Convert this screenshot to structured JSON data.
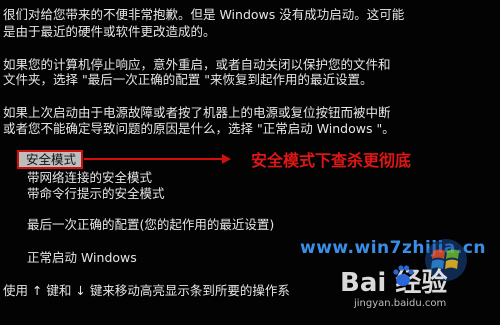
{
  "screen": {
    "intro_lines": [
      "很们对给您带来的不便非常抱歉。但是 Windows 没有成功启动。这可能",
      "是由于最近的硬件或软件更改造成的。"
    ],
    "para2_lines": [
      "如果您的计算机停止响应，意外重启，或者自动关闭以保护您的文件和",
      "文件夹，选择 \"最后一次正确的配置 \"来恢复到起作用的最近设置。"
    ],
    "para3_lines": [
      "如果上次启动由于电源故障或者按了机器上的电源或复位按钮而被中断",
      "或者您不能确定导致问题的原因是什么，选择 \"正常启动 Windows \"。"
    ],
    "options": [
      "安全模式",
      "带网络连接的安全模式",
      "带命令行提示的安全模式",
      "最后一次正确的配置(您的起作用的最近设置)",
      "正常启动 Windows"
    ],
    "selected_index": 0,
    "footer": "使用 ↑ 键和 ↓ 键来移动高亮显示条到所要的操作系"
  },
  "annotation": {
    "text": "安全模式下查杀更彻底",
    "color": "#e01616"
  },
  "watermark": {
    "site": "www.win7zhijia.cn",
    "logo": "Bai 经验",
    "sub": "jingyan.baidu.com"
  },
  "icons": {
    "windows_flag": "windows-flag-icon",
    "baidu_paw": "baidu-paw-icon"
  }
}
